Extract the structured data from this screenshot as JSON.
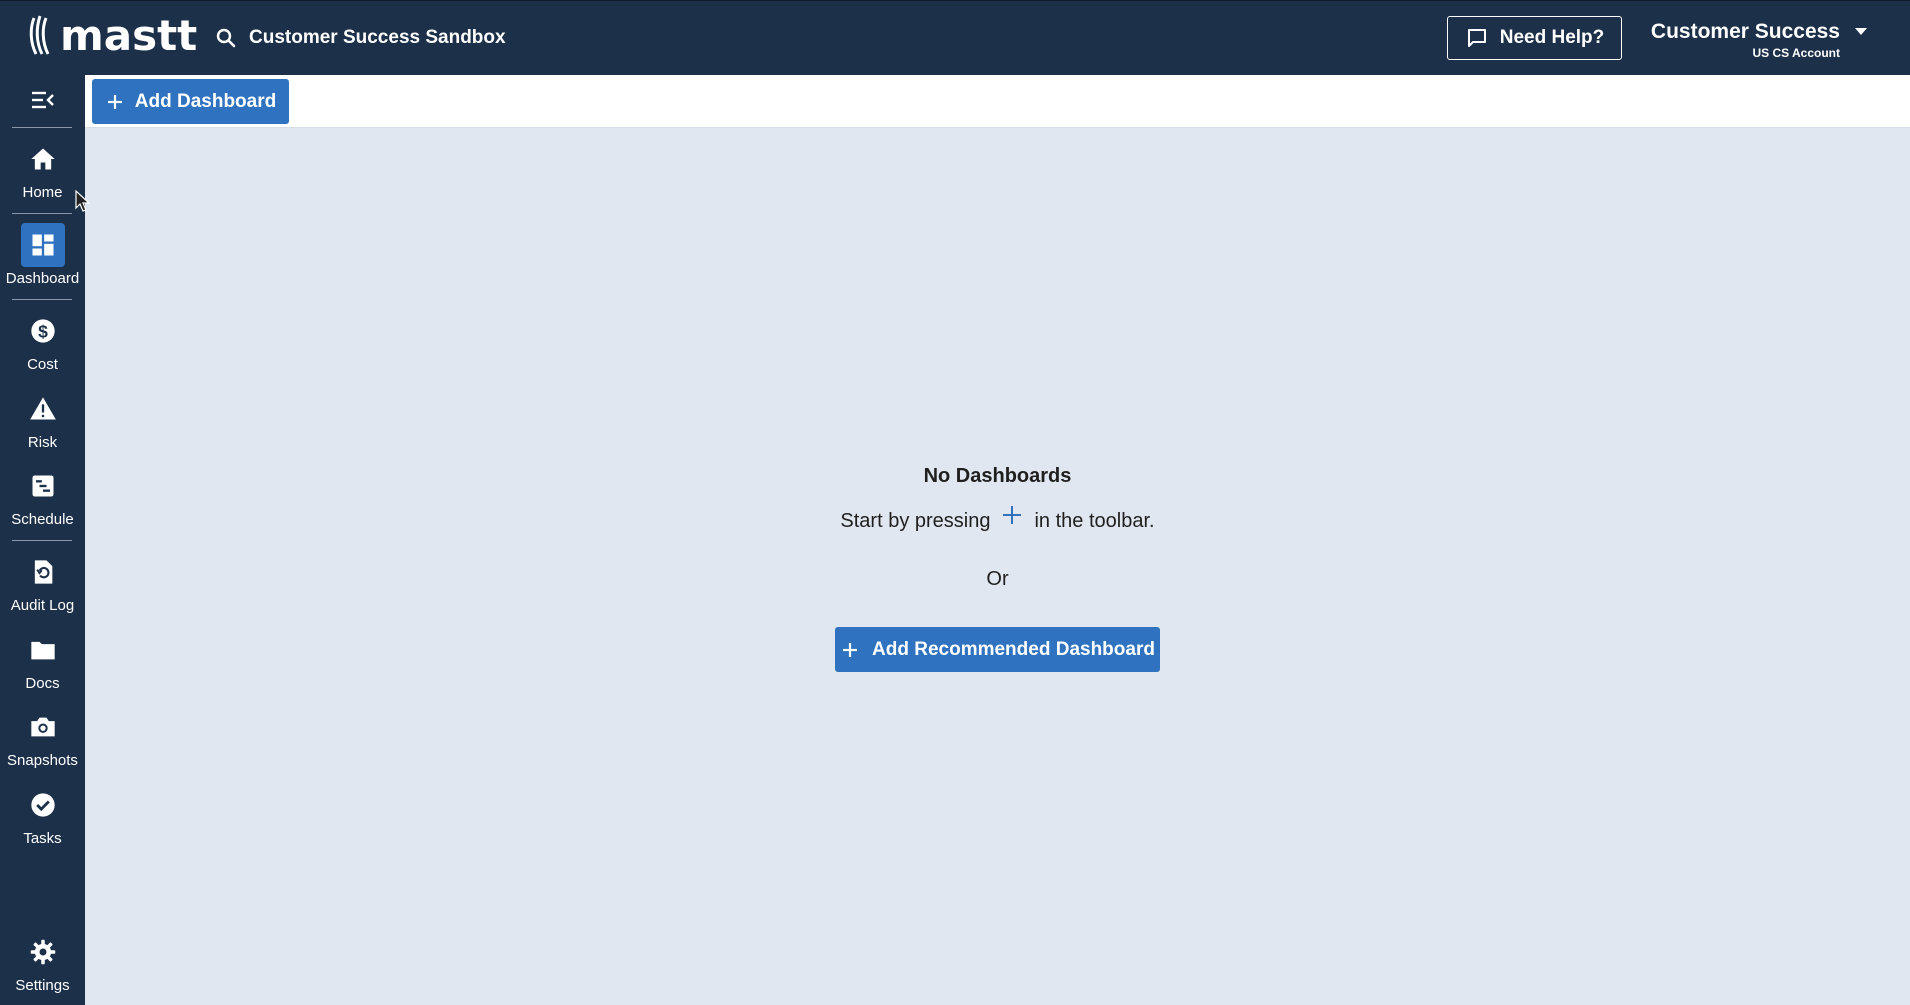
{
  "header": {
    "logo_text": "mastt",
    "project_name": "Customer Success Sandbox",
    "help_label": "Need Help?",
    "account_name": "Customer Success",
    "account_sub": "US CS Account"
  },
  "sidebar": {
    "items": [
      {
        "label": "Home",
        "icon": "home-icon"
      },
      {
        "label": "Dashboard",
        "icon": "dashboard-icon",
        "active": true
      },
      {
        "label": "Cost",
        "icon": "dollar-icon"
      },
      {
        "label": "Risk",
        "icon": "warning-icon"
      },
      {
        "label": "Schedule",
        "icon": "schedule-icon"
      },
      {
        "label": "Audit Log",
        "icon": "audit-log-icon"
      },
      {
        "label": "Docs",
        "icon": "folder-icon"
      },
      {
        "label": "Snapshots",
        "icon": "camera-icon"
      },
      {
        "label": "Tasks",
        "icon": "check-circle-icon"
      },
      {
        "label": "Settings",
        "icon": "gear-icon"
      }
    ]
  },
  "toolbar": {
    "add_dashboard_label": "Add Dashboard"
  },
  "empty_state": {
    "title": "No Dashboards",
    "hint_before": "Start by pressing",
    "hint_after": "in the toolbar.",
    "or": "Or",
    "recommended_label": "Add Recommended Dashboard"
  },
  "colors": {
    "nav_bg": "#1c3049",
    "accent": "#2e72c0",
    "content_bg": "#e1e7f0"
  }
}
